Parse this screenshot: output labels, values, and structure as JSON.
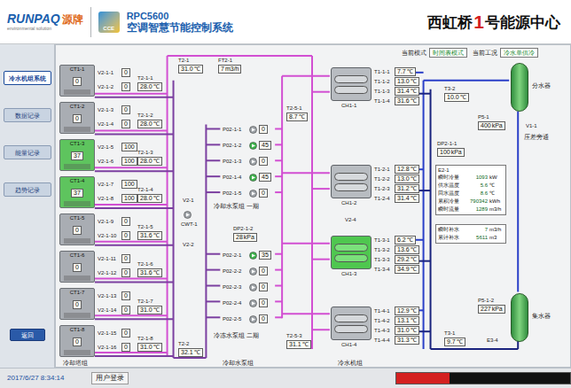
{
  "header": {
    "brand": "RUNPAQ",
    "brand_cn": "源牌",
    "tagline": "environmental solution",
    "badge": "CCE",
    "product": "RPC5600",
    "system": "空调智慧节能控制系统",
    "site_a": "西虹桥",
    "site_num": "1",
    "site_b": "号能源中心"
  },
  "status": [
    {
      "label": "当前模式",
      "value": "时间表模式"
    },
    {
      "label": "当前工况",
      "value": "冷水单供冷"
    }
  ],
  "sidebar": {
    "items": [
      {
        "label": "冷水机组系统",
        "selected": true
      },
      {
        "label": "数据记录",
        "selected": false
      },
      {
        "label": "能量记录",
        "selected": false
      },
      {
        "label": "趋势记录",
        "selected": false
      }
    ],
    "back": "返回"
  },
  "towers": [
    {
      "name": "CT1-1",
      "fan": "0",
      "running": false
    },
    {
      "name": "CT1-2",
      "fan": "0",
      "running": false
    },
    {
      "name": "CT1-3",
      "fan": "37",
      "running": true
    },
    {
      "name": "CT1-4",
      "fan": "37",
      "running": true
    },
    {
      "name": "CT1-5",
      "fan": "0",
      "running": false
    },
    {
      "name": "CT1-6",
      "fan": "0",
      "running": false
    },
    {
      "name": "CT1-7",
      "fan": "0",
      "running": false
    },
    {
      "name": "CT1-8",
      "fan": "0",
      "running": false
    }
  ],
  "tower_valves": [
    {
      "name": "V2-1-1",
      "value": "0"
    },
    {
      "name": "V2-1-2",
      "value": "0"
    },
    {
      "name": "V2-1-3",
      "value": "0"
    },
    {
      "name": "V2-1-4",
      "value": "0"
    },
    {
      "name": "V2-1-5",
      "value": "100"
    },
    {
      "name": "V2-1-6",
      "value": "100"
    },
    {
      "name": "V2-1-7",
      "value": "100"
    },
    {
      "name": "V2-1-8",
      "value": "100"
    },
    {
      "name": "V2-1-9",
      "value": "0"
    },
    {
      "name": "V2-1-10",
      "value": "0"
    },
    {
      "name": "V2-1-11",
      "value": "0"
    },
    {
      "name": "V2-1-12",
      "value": "0"
    },
    {
      "name": "V2-1-13",
      "value": "0"
    },
    {
      "name": "V2-1-14",
      "value": "0"
    },
    {
      "name": "V2-1-15",
      "value": "0"
    },
    {
      "name": "V2-1-16",
      "value": "0"
    }
  ],
  "tower_temps": [
    {
      "name": "T2-1-1",
      "value": "28.0",
      "unit": "℃"
    },
    {
      "name": "T2-1-2",
      "value": "28.0",
      "unit": "℃"
    },
    {
      "name": "T2-1-3",
      "value": "28.0",
      "unit": "℃"
    },
    {
      "name": "T2-1-4",
      "value": "28.0",
      "unit": "℃"
    },
    {
      "name": "T2-1-5",
      "value": "31.6",
      "unit": "℃"
    },
    {
      "name": "T2-1-6",
      "value": "31.6",
      "unit": "℃"
    },
    {
      "name": "T2-1-7",
      "value": "31.0",
      "unit": "℃"
    },
    {
      "name": "T2-1-8",
      "value": "31.0",
      "unit": "℃"
    }
  ],
  "sensors": [
    {
      "name": "T2-1",
      "value": "31.0",
      "unit": "℃"
    },
    {
      "name": "FT2-1",
      "value": "7",
      "unit": "m3/h"
    },
    {
      "name": "T2-2",
      "value": "32.1",
      "unit": "℃"
    },
    {
      "name": "T2-5-1",
      "value": "8.7",
      "unit": "℃"
    },
    {
      "name": "DP2-1-1",
      "value": "100",
      "unit": "kPa"
    },
    {
      "name": "DP2-1-2",
      "value": "28",
      "unit": "kPa"
    },
    {
      "name": "T2-5-3",
      "value": "31.1",
      "unit": "℃"
    },
    {
      "name": "T3-2",
      "value": "10.0",
      "unit": "℃"
    },
    {
      "name": "P5-1",
      "value": "400",
      "unit": "kPa"
    },
    {
      "name": "P5-1-2",
      "value": "227",
      "unit": "kPa"
    },
    {
      "name": "T3-1",
      "value": "9.7",
      "unit": "℃"
    }
  ],
  "tags": [
    "CWT-1",
    "V2-1",
    "V2-2",
    "V2-4",
    "V1-1",
    "E3-4"
  ],
  "pump_groups": [
    {
      "label": "冷却水泵组 一期",
      "pumps": [
        {
          "name": "P02-1-1",
          "speed": "0",
          "running": false
        },
        {
          "name": "P02-1-2",
          "speed": "45",
          "running": true
        },
        {
          "name": "P02-1-3",
          "speed": "0",
          "running": false
        },
        {
          "name": "P02-1-4",
          "speed": "45",
          "running": true
        },
        {
          "name": "P02-1-5",
          "speed": "0",
          "running": false
        }
      ]
    },
    {
      "label": "冷冻水泵组 二期",
      "pumps": [
        {
          "name": "P02-2-1",
          "speed": "35",
          "running": true
        },
        {
          "name": "P02-2-2",
          "speed": "0",
          "running": false
        },
        {
          "name": "P02-2-3",
          "speed": "0",
          "running": false
        },
        {
          "name": "P02-2-4",
          "speed": "0",
          "running": false
        },
        {
          "name": "P02-2-5",
          "speed": "0",
          "running": false
        }
      ]
    }
  ],
  "chillers": [
    {
      "name": "CH1-1",
      "running": false,
      "temps": [
        {
          "name": "T1-1-1",
          "value": "7.7",
          "unit": "℃"
        },
        {
          "name": "T1-1-2",
          "value": "13.0",
          "unit": "℃"
        },
        {
          "name": "T1-1-3",
          "value": "31.4",
          "unit": "℃"
        },
        {
          "name": "T1-1-4",
          "value": "31.6",
          "unit": "℃"
        }
      ]
    },
    {
      "name": "CH1-2",
      "running": false,
      "temps": [
        {
          "name": "T1-2-1",
          "value": "12.8",
          "unit": "℃"
        },
        {
          "name": "T1-2-2",
          "value": "13.0",
          "unit": "℃"
        },
        {
          "name": "T1-2-3",
          "value": "31.2",
          "unit": "℃"
        },
        {
          "name": "T1-2-4",
          "value": "31.4",
          "unit": "℃"
        }
      ]
    },
    {
      "name": "CH1-3",
      "running": true,
      "temps": [
        {
          "name": "T1-3-1",
          "value": "6.2",
          "unit": "℃"
        },
        {
          "name": "T1-3-2",
          "value": "13.6",
          "unit": "℃"
        },
        {
          "name": "T1-3-3",
          "value": "29.2",
          "unit": "℃"
        },
        {
          "name": "T1-3-4",
          "value": "34.9",
          "unit": "℃"
        }
      ]
    },
    {
      "name": "CH1-4",
      "running": false,
      "temps": [
        {
          "name": "T1-4-1",
          "value": "12.9",
          "unit": "℃"
        },
        {
          "name": "T1-4-2",
          "value": "13.1",
          "unit": "℃"
        },
        {
          "name": "T1-4-3",
          "value": "31.0",
          "unit": "℃"
        },
        {
          "name": "T1-4-4",
          "value": "31.3",
          "unit": "℃"
        }
      ]
    }
  ],
  "headers": [
    "分水器",
    "集水器"
  ],
  "bypass": "压差旁通",
  "energy": {
    "title": "E2-1",
    "rows": [
      {
        "label": "瞬时冷量",
        "value": "1093",
        "unit": "kW"
      },
      {
        "label": "供水温度",
        "value": "5.6",
        "unit": "℃"
      },
      {
        "label": "回水温度",
        "value": "8.6",
        "unit": "℃"
      },
      {
        "label": "累积冷量",
        "value": "790342",
        "unit": "kWh"
      },
      {
        "label": "瞬时流量",
        "value": "1289",
        "unit": "m3/h"
      }
    ]
  },
  "makeup": {
    "rows": [
      {
        "label": "瞬时补水",
        "value": "7",
        "unit": "m3/h"
      },
      {
        "label": "累计补水",
        "value": "5611",
        "unit": "m3"
      }
    ]
  },
  "captions": [
    "冷却塔组",
    "冷却水泵组",
    "冷水机组"
  ],
  "footer": {
    "datetime": "2017/6/27 8:34:14",
    "login": "用户登录",
    "alarm_active": true
  }
}
